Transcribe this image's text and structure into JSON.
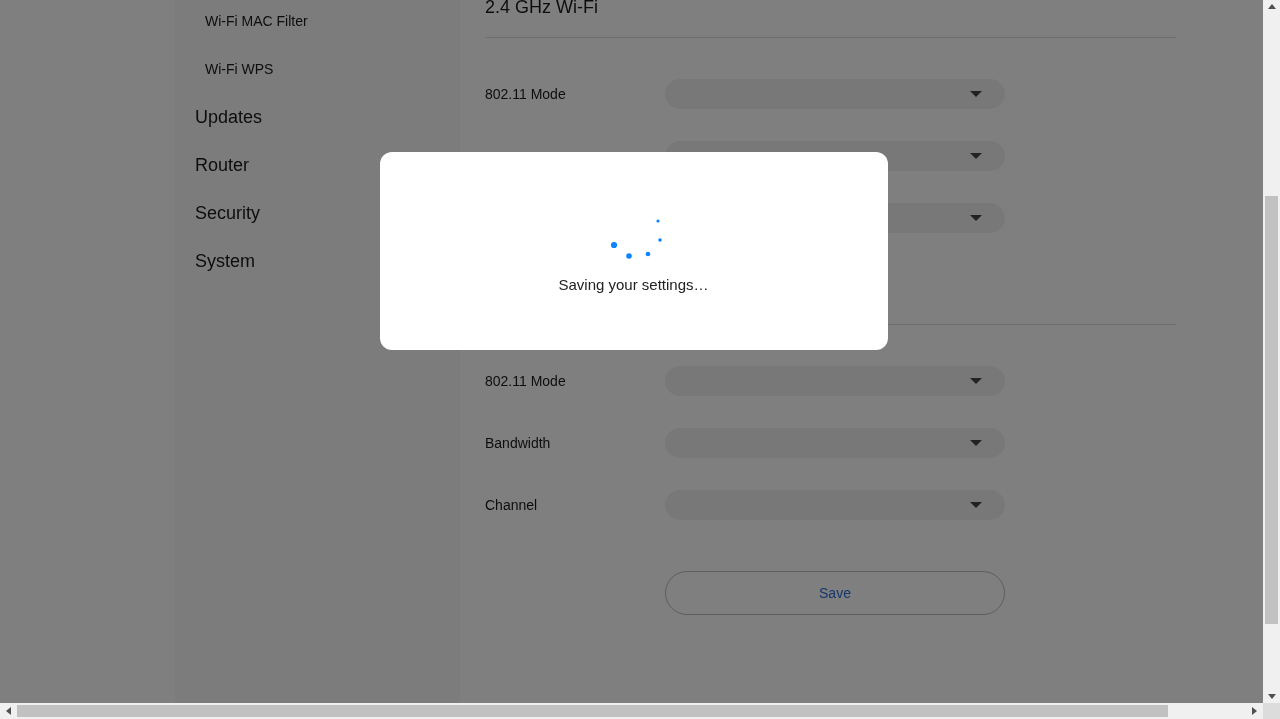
{
  "sidebar": {
    "items": [
      {
        "label": "Wi-Fi MAC Filter",
        "kind": "sub"
      },
      {
        "label": "Wi-Fi WPS",
        "kind": "sub"
      },
      {
        "label": "Updates",
        "kind": "main"
      },
      {
        "label": "Router",
        "kind": "main"
      },
      {
        "label": "Security",
        "kind": "main"
      },
      {
        "label": "System",
        "kind": "main"
      }
    ]
  },
  "sections": [
    {
      "title": "2.4 GHz Wi-Fi",
      "fields": [
        {
          "kind": "labeled",
          "label": "802.11 Mode"
        },
        {
          "kind": "unlabeled"
        },
        {
          "kind": "unlabeled"
        }
      ]
    },
    {
      "fields": [
        {
          "kind": "labeled",
          "label": "802.11 Mode"
        },
        {
          "kind": "labeled",
          "label": "Bandwidth"
        },
        {
          "kind": "labeled",
          "label": "Channel"
        }
      ]
    }
  ],
  "save_button": "Save",
  "modal": {
    "message": "Saving your settings…"
  }
}
